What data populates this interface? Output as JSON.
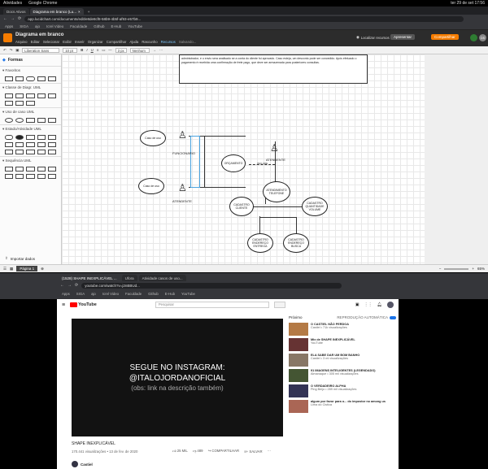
{
  "system": {
    "activities": "Atividades",
    "app": "Google Chrome",
    "clock": "ter 29 de set 17:56"
  },
  "chrome": {
    "tabs": [
      "Docs Ativos",
      "Diagrama em branco (Lu...",
      "+"
    ],
    "url": "app.lucidchart.com/documents/edit/e8de8cf8-58b9-4b5f-af93-e57b9...",
    "bookmarks": [
      "Apps",
      "SIGA",
      "ajo",
      "Icrel Video",
      "Faculdade",
      "Github",
      "E-Hub",
      "YouTube"
    ]
  },
  "drawio": {
    "title": "Diagrama em branco",
    "menus": [
      "Arquivo",
      "Editar",
      "Selecionar",
      "Exibir",
      "Inserir",
      "Organizar",
      "Compartilhar",
      "Ajuda",
      "Rascunho",
      "Recursos",
      "Salvando..."
    ],
    "location": "Localizar recursos",
    "present": "Apresentar",
    "share": "Compartilhar",
    "avatar": "DS",
    "font": "Liberation Sans",
    "size": "10 pt",
    "stroke": "3 px",
    "stroke_style": "Nenhum"
  },
  "sidebar": {
    "title": "Formas",
    "sections": [
      "Favoritos",
      "Classe de Diagr. UML",
      "Uso de caso UML",
      "Estado/Atividade UML",
      "Sequência UML"
    ],
    "import": "Importar dados"
  },
  "canvas": {
    "note": "administrador, e o envio sera analisado se a conta do cliente foi aprovado. Caso esteja, um desconto pode ser concedido. Após efetuado o pagamento é recebida uma confirmação de frete pago, que deve ser armazenada para posteriores consultas.",
    "actors": [
      "FUNCIONARIO",
      "ATENDENTE",
      "ATENDENTE"
    ],
    "nodes": [
      "Caso de uso",
      "Caso de uso",
      "ORÇAMENTO",
      "ATENDIMENTO TELEFONE",
      "CADASTRO CLIENTE",
      "CADASTRO QUANTIDADE VOLUME",
      "CADASTRO ENDEREÇO ENTREGA",
      "CADASTRO ENDEREÇO BUSCA"
    ],
    "include": "INCLUDE"
  },
  "pages": {
    "tab": "Página 1",
    "zoom": "65%"
  },
  "yt_tabs": [
    "(1528) SHAPE INEXPLICÁVEL ...",
    "Ufora",
    "Atividade casos de uso..."
  ],
  "yt_url": "youtube.com/watch?v=j2nBBUd...",
  "youtube": {
    "search_placeholder": "Pesquisar",
    "video_text": [
      "SEGUE NO INSTAGRAM:",
      "@ITALOJORDANOFICIAL",
      "(obs: link na descrição também)"
    ],
    "title": "SHAPE INEXPLICÁVEL",
    "views": "170.441 visualizações • 13 de fev. de 2020",
    "likes": "25 MIL",
    "dislikes": "489",
    "share": "COMPARTILHAR",
    "save": "SALVAR",
    "channel": "Castiel",
    "next": "Próximo",
    "autoplay": "REPRODUÇÃO AUTOMÁTICA",
    "recs": [
      {
        "title": "O CASTIEL NÃO PERDOA",
        "meta": "Castiel • 71k visualizações"
      },
      {
        "title": "Mix de SHAPE INEXPLICÁVEL",
        "meta": "YouTube"
      },
      {
        "title": "ELA SABE DAR UM BOM BANHO",
        "meta": "Castiel • 3 mi visualizações"
      },
      {
        "title": "91 IMAGENS INTELIGENTES (LEGENDADO)",
        "meta": "Almanaque • 305 mil visualizações"
      },
      {
        "title": "O VERDADEIRO ALPHA",
        "meta": "Ping Beijo • 289 mil visualizações"
      },
      {
        "title": "algum por favor para o... do impostor no among us",
        "meta": "Lima do Cistica"
      }
    ]
  }
}
